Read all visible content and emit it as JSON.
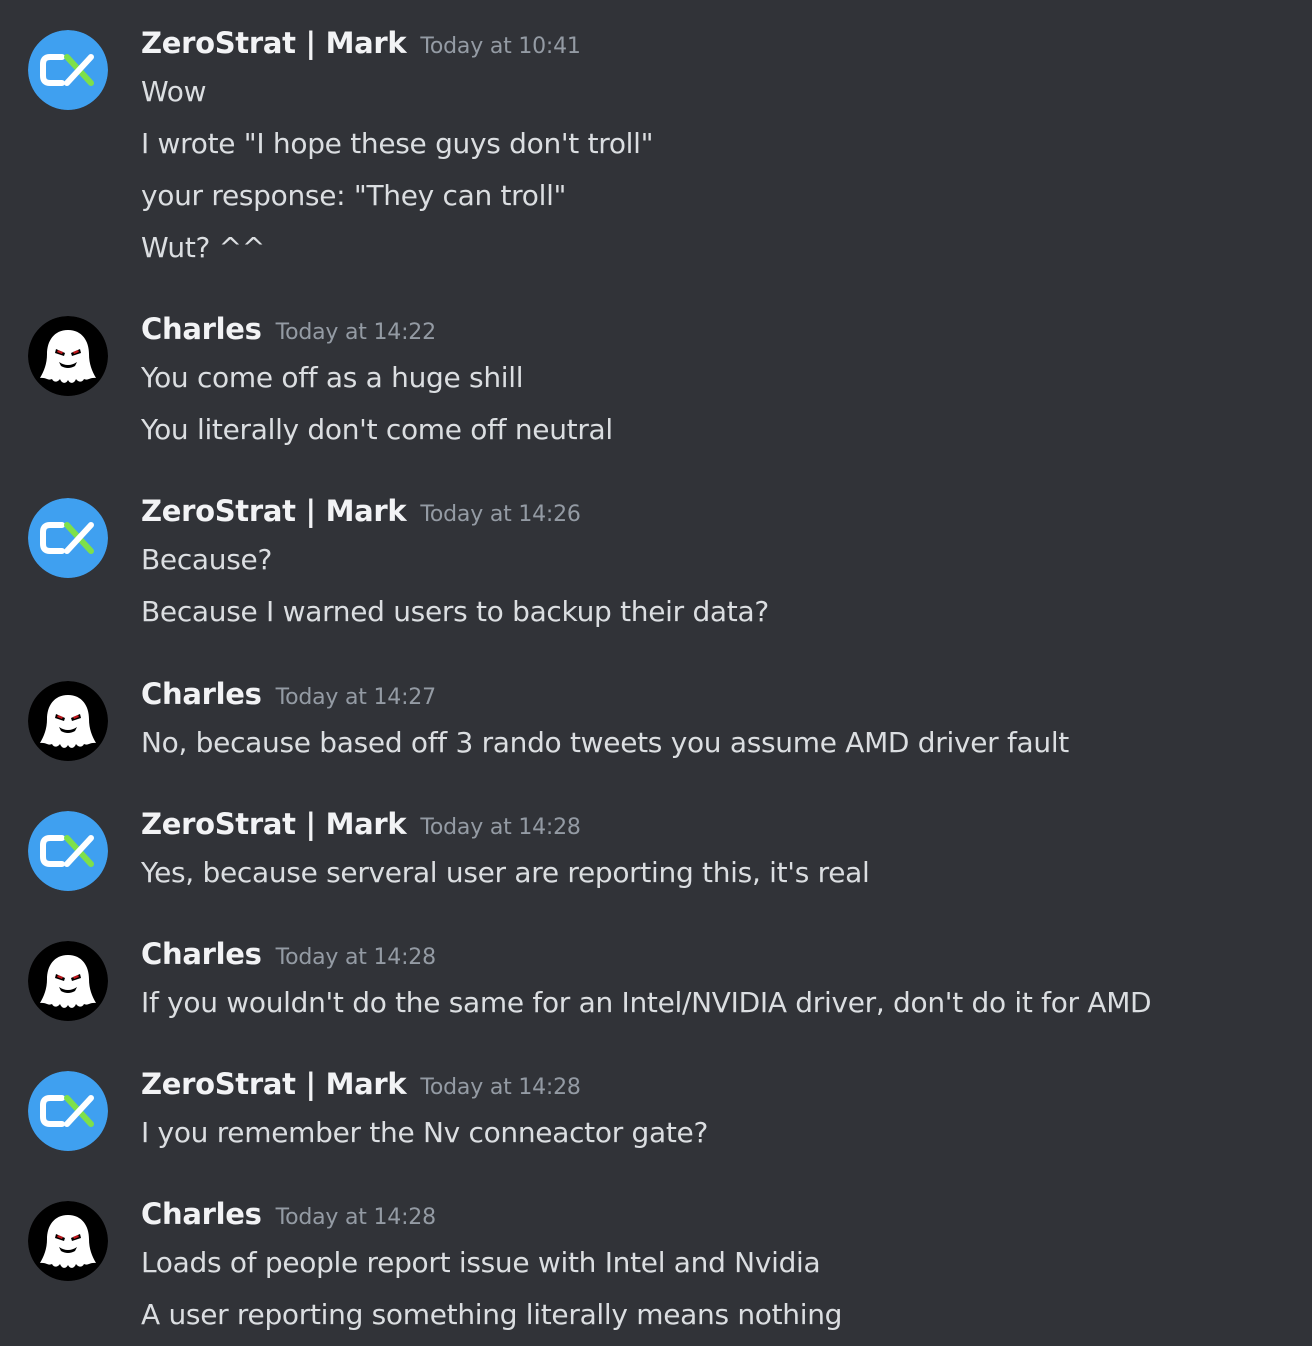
{
  "messages": [
    {
      "author": "ZeroStrat | Mark",
      "avatar_icon": "zerostrat-cx-logo-icon",
      "timestamp": "Today at 10:41",
      "lines": [
        "Wow",
        "I wrote \"I hope these guys don't troll\"",
        "your response: \"They can troll\"",
        "Wut? ^^"
      ]
    },
    {
      "author": "Charles",
      "avatar_icon": "ghost-avatar-icon",
      "timestamp": "Today at 14:22",
      "lines": [
        "You come off as a huge shill",
        "You literally don't come off neutral"
      ]
    },
    {
      "author": "ZeroStrat | Mark",
      "avatar_icon": "zerostrat-cx-logo-icon",
      "timestamp": "Today at 14:26",
      "lines": [
        "Because?",
        "Because I warned users to backup their data?"
      ]
    },
    {
      "author": "Charles",
      "avatar_icon": "ghost-avatar-icon",
      "timestamp": "Today at 14:27",
      "lines": [
        "No, because based off 3 rando tweets you assume AMD driver fault"
      ]
    },
    {
      "author": "ZeroStrat | Mark",
      "avatar_icon": "zerostrat-cx-logo-icon",
      "timestamp": "Today at 14:28",
      "lines": [
        "Yes, because serveral user are reporting this, it's real"
      ]
    },
    {
      "author": "Charles",
      "avatar_icon": "ghost-avatar-icon",
      "timestamp": "Today at 14:28",
      "lines": [
        "If you wouldn't do the same for an Intel/NVIDIA driver, don't do it for AMD"
      ]
    },
    {
      "author": "ZeroStrat | Mark",
      "avatar_icon": "zerostrat-cx-logo-icon",
      "timestamp": "Today at 14:28",
      "lines": [
        "I you remember the Nv conneactor gate?"
      ]
    },
    {
      "author": "Charles",
      "avatar_icon": "ghost-avatar-icon",
      "timestamp": "Today at 14:28",
      "lines": [
        "Loads of people report issue with Intel and Nvidia",
        "A user reporting something literally means nothing"
      ]
    }
  ],
  "colors": {
    "background": "#313338",
    "username": "#f2f3f5",
    "timestamp": "#949ba4",
    "message_text": "#dbdee1",
    "zerostrat_avatar_bg": "#3fa0f0",
    "zerostrat_logo_green": "#7ee04a",
    "ghost_avatar_bg": "#000000"
  }
}
